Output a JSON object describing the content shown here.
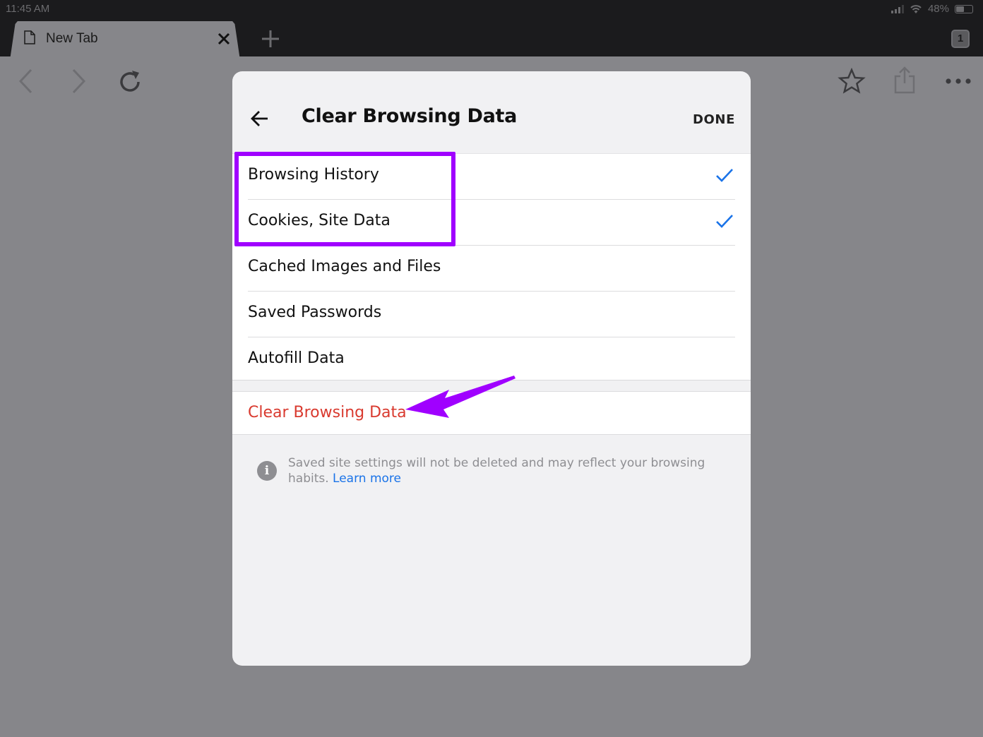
{
  "status_bar": {
    "time": "11:45 AM",
    "battery": "48%",
    "battery_level": 0.48
  },
  "tab_strip": {
    "active_tab_title": "New Tab",
    "tab_count": "1"
  },
  "toolbar": {
    "icons": [
      "back-icon",
      "forward-icon",
      "reload-icon",
      "star-icon",
      "share-icon",
      "more-icon"
    ]
  },
  "dialog": {
    "title": "Clear Browsing Data",
    "done_label": "DONE",
    "options": [
      {
        "label": "Browsing History",
        "checked": true
      },
      {
        "label": "Cookies, Site Data",
        "checked": true
      },
      {
        "label": "Cached Images and Files",
        "checked": false
      },
      {
        "label": "Saved Passwords",
        "checked": false
      },
      {
        "label": "Autofill Data",
        "checked": false
      }
    ],
    "clear_action_label": "Clear Browsing Data",
    "info_text": "Saved site settings will not be deleted and may reflect your browsing habits.",
    "learn_more_label": "Learn more"
  },
  "colors": {
    "accent_check": "#1a73e8",
    "destructive": "#d93a2f",
    "annotation": "#a000ff"
  }
}
